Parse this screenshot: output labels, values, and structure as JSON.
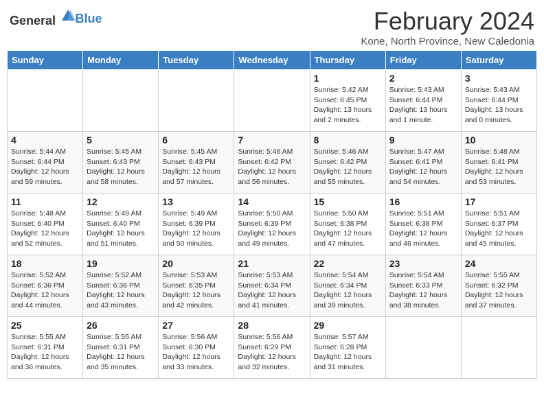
{
  "header": {
    "logo_general": "General",
    "logo_blue": "Blue",
    "title": "February 2024",
    "subtitle": "Kone, North Province, New Caledonia"
  },
  "weekdays": [
    "Sunday",
    "Monday",
    "Tuesday",
    "Wednesday",
    "Thursday",
    "Friday",
    "Saturday"
  ],
  "weeks": [
    [
      {
        "day": "",
        "detail": ""
      },
      {
        "day": "",
        "detail": ""
      },
      {
        "day": "",
        "detail": ""
      },
      {
        "day": "",
        "detail": ""
      },
      {
        "day": "1",
        "detail": "Sunrise: 5:42 AM\nSunset: 6:45 PM\nDaylight: 13 hours\nand 2 minutes."
      },
      {
        "day": "2",
        "detail": "Sunrise: 5:43 AM\nSunset: 6:44 PM\nDaylight: 13 hours\nand 1 minute."
      },
      {
        "day": "3",
        "detail": "Sunrise: 5:43 AM\nSunset: 6:44 PM\nDaylight: 13 hours\nand 0 minutes."
      }
    ],
    [
      {
        "day": "4",
        "detail": "Sunrise: 5:44 AM\nSunset: 6:44 PM\nDaylight: 12 hours\nand 59 minutes."
      },
      {
        "day": "5",
        "detail": "Sunrise: 5:45 AM\nSunset: 6:43 PM\nDaylight: 12 hours\nand 58 minutes."
      },
      {
        "day": "6",
        "detail": "Sunrise: 5:45 AM\nSunset: 6:43 PM\nDaylight: 12 hours\nand 57 minutes."
      },
      {
        "day": "7",
        "detail": "Sunrise: 5:46 AM\nSunset: 6:42 PM\nDaylight: 12 hours\nand 56 minutes."
      },
      {
        "day": "8",
        "detail": "Sunrise: 5:46 AM\nSunset: 6:42 PM\nDaylight: 12 hours\nand 55 minutes."
      },
      {
        "day": "9",
        "detail": "Sunrise: 5:47 AM\nSunset: 6:41 PM\nDaylight: 12 hours\nand 54 minutes."
      },
      {
        "day": "10",
        "detail": "Sunrise: 5:48 AM\nSunset: 6:41 PM\nDaylight: 12 hours\nand 53 minutes."
      }
    ],
    [
      {
        "day": "11",
        "detail": "Sunrise: 5:48 AM\nSunset: 6:40 PM\nDaylight: 12 hours\nand 52 minutes."
      },
      {
        "day": "12",
        "detail": "Sunrise: 5:49 AM\nSunset: 6:40 PM\nDaylight: 12 hours\nand 51 minutes."
      },
      {
        "day": "13",
        "detail": "Sunrise: 5:49 AM\nSunset: 6:39 PM\nDaylight: 12 hours\nand 50 minutes."
      },
      {
        "day": "14",
        "detail": "Sunrise: 5:50 AM\nSunset: 6:39 PM\nDaylight: 12 hours\nand 49 minutes."
      },
      {
        "day": "15",
        "detail": "Sunrise: 5:50 AM\nSunset: 6:38 PM\nDaylight: 12 hours\nand 47 minutes."
      },
      {
        "day": "16",
        "detail": "Sunrise: 5:51 AM\nSunset: 6:38 PM\nDaylight: 12 hours\nand 46 minutes."
      },
      {
        "day": "17",
        "detail": "Sunrise: 5:51 AM\nSunset: 6:37 PM\nDaylight: 12 hours\nand 45 minutes."
      }
    ],
    [
      {
        "day": "18",
        "detail": "Sunrise: 5:52 AM\nSunset: 6:36 PM\nDaylight: 12 hours\nand 44 minutes."
      },
      {
        "day": "19",
        "detail": "Sunrise: 5:52 AM\nSunset: 6:36 PM\nDaylight: 12 hours\nand 43 minutes."
      },
      {
        "day": "20",
        "detail": "Sunrise: 5:53 AM\nSunset: 6:35 PM\nDaylight: 12 hours\nand 42 minutes."
      },
      {
        "day": "21",
        "detail": "Sunrise: 5:53 AM\nSunset: 6:34 PM\nDaylight: 12 hours\nand 41 minutes."
      },
      {
        "day": "22",
        "detail": "Sunrise: 5:54 AM\nSunset: 6:34 PM\nDaylight: 12 hours\nand 39 minutes."
      },
      {
        "day": "23",
        "detail": "Sunrise: 5:54 AM\nSunset: 6:33 PM\nDaylight: 12 hours\nand 38 minutes."
      },
      {
        "day": "24",
        "detail": "Sunrise: 5:55 AM\nSunset: 6:32 PM\nDaylight: 12 hours\nand 37 minutes."
      }
    ],
    [
      {
        "day": "25",
        "detail": "Sunrise: 5:55 AM\nSunset: 6:31 PM\nDaylight: 12 hours\nand 36 minutes."
      },
      {
        "day": "26",
        "detail": "Sunrise: 5:55 AM\nSunset: 6:31 PM\nDaylight: 12 hours\nand 35 minutes."
      },
      {
        "day": "27",
        "detail": "Sunrise: 5:56 AM\nSunset: 6:30 PM\nDaylight: 12 hours\nand 33 minutes."
      },
      {
        "day": "28",
        "detail": "Sunrise: 5:56 AM\nSunset: 6:29 PM\nDaylight: 12 hours\nand 32 minutes."
      },
      {
        "day": "29",
        "detail": "Sunrise: 5:57 AM\nSunset: 6:28 PM\nDaylight: 12 hours\nand 31 minutes."
      },
      {
        "day": "",
        "detail": ""
      },
      {
        "day": "",
        "detail": ""
      }
    ]
  ]
}
